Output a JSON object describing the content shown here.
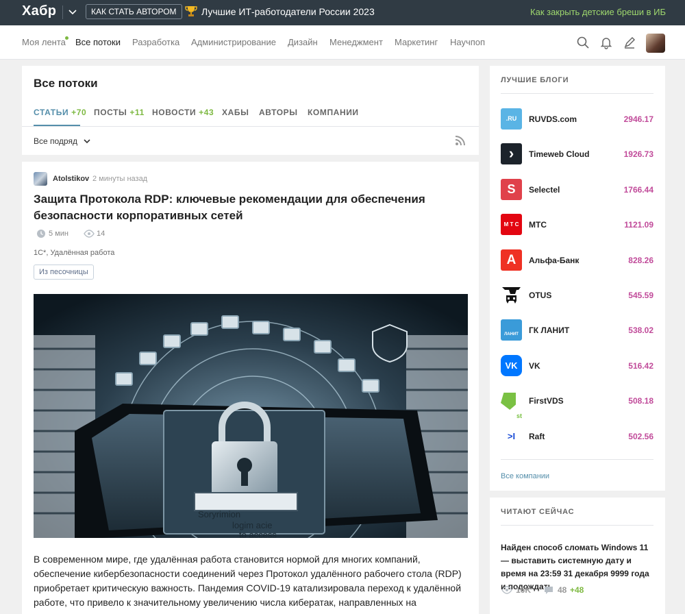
{
  "topbar": {
    "logo": "Хабр",
    "author_button": "КАК СТАТЬ АВТОРОМ",
    "promo": "Лучшие ИТ-работодатели России 2023",
    "promo_right": "Как закрыть детские бреши в ИБ"
  },
  "nav": {
    "items": [
      "Моя лента",
      "Все потоки",
      "Разработка",
      "Администрирование",
      "Дизайн",
      "Менеджмент",
      "Маркетинг",
      "Научпоп"
    ],
    "active": "Все потоки"
  },
  "feed": {
    "title": "Все потоки",
    "tabs": [
      {
        "label": "СТАТЬИ",
        "count": "+70"
      },
      {
        "label": "ПОСТЫ",
        "count": "+11"
      },
      {
        "label": "НОВОСТИ",
        "count": "+43"
      },
      {
        "label": "ХАБЫ",
        "count": ""
      },
      {
        "label": "АВТОРЫ",
        "count": ""
      },
      {
        "label": "КОМПАНИИ",
        "count": ""
      }
    ],
    "sort": "Все подряд"
  },
  "post": {
    "author": "Atolstikov",
    "time": "2 минуты назад",
    "title": "Защита Протокола RDP: ключевые рекомендации для обеспечения безопасности корпоративных сетей",
    "reading_time": "5 мин",
    "views": "14",
    "hubs": "1С*, Удалённая работа",
    "badge": "Из песочницы",
    "image_text": [
      "Sorуrimion",
      "logim acie",
      "to access"
    ],
    "text": "В современном мире, где удалённая работа становится нормой для многих компаний, обеспечение кибербезопасности соединений через Протокол удалённого рабочего стола (RDP) приобретает критическую важность. Пандемия COVID-19 катализировала переход к удалённой работе, что привело к значительному увеличению числа кибератак, направленных на"
  },
  "best_blogs": {
    "heading": "ЛУЧШИЕ БЛОГИ",
    "items": [
      {
        "name": "RUVDS.com",
        "score": "2946.17",
        "color": "#5ab4e5",
        "icon": "ruvds-logo",
        "glyph": ".RU"
      },
      {
        "name": "Timeweb Cloud",
        "score": "1926.73",
        "color": "#1c232b",
        "icon": "timeweb-logo",
        "glyph": "›"
      },
      {
        "name": "Selectel",
        "score": "1766.44",
        "color": "#e0414b",
        "icon": "selectel-logo",
        "glyph": "S"
      },
      {
        "name": "МТС",
        "score": "1121.09",
        "color": "#e30611",
        "icon": "mts-logo",
        "glyph": "М Т С"
      },
      {
        "name": "Альфа-Банк",
        "score": "828.26",
        "color": "#ef3124",
        "icon": "alfa-logo",
        "glyph": "А"
      },
      {
        "name": "OTUS",
        "score": "545.59",
        "color": "#ffffff",
        "icon": "otus-logo",
        "glyph": ""
      },
      {
        "name": "ГК ЛАНИТ",
        "score": "538.02",
        "color": "#3a9bd9",
        "icon": "lanit-logo",
        "glyph": "ЛАНИТ"
      },
      {
        "name": "VK",
        "score": "516.42",
        "color": "#0077ff",
        "icon": "vk-logo",
        "glyph": "VK"
      },
      {
        "name": "FirstVDS",
        "score": "508.18",
        "color": "#7ac143",
        "icon": "firstvds-logo",
        "glyph": "st"
      },
      {
        "name": "Raft",
        "score": "502.56",
        "color": "#ffffff",
        "icon": "raft-logo",
        "glyph": ">I"
      }
    ],
    "all_link": "Все компании"
  },
  "reading_now": {
    "heading": "ЧИТАЮТ СЕЙЧАС",
    "title": "Найден способ сломать Windows 11 — выставить системную дату и время на 23:59 31 декабря 9999 года и подождать",
    "views": "16K",
    "comments": "48",
    "comments_new": "+48"
  },
  "colors": {
    "topbar": "#303b44",
    "accent": "#548eaa",
    "green": "#7eb942",
    "score": "#c14b9a"
  }
}
